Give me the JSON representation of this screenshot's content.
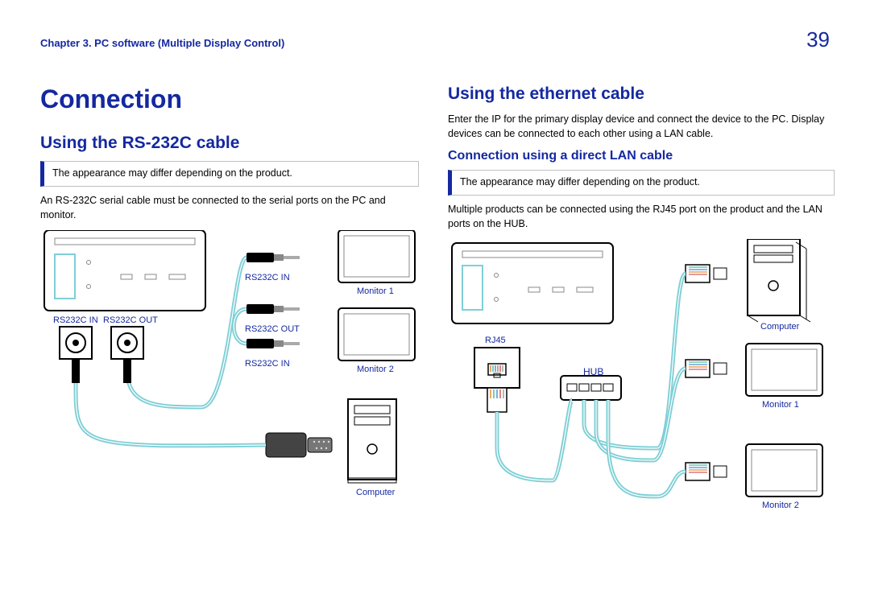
{
  "header": {
    "chapter": "Chapter 3. PC software (Multiple Display Control)",
    "page": "39"
  },
  "left": {
    "title": "Connection",
    "section": "Using the RS-232C cable",
    "note": "The appearance may differ depending on the product.",
    "body": "An RS-232C serial cable must be connected to the serial ports on the PC and monitor.",
    "labels": {
      "rs232c_in_left": "RS232C IN",
      "rs232c_out_left": "RS232C OUT",
      "rs232c_in_top": "RS232C IN",
      "rs232c_out_mid": "RS232C OUT",
      "rs232c_in_bot": "RS232C IN",
      "monitor1": "Monitor 1",
      "monitor2": "Monitor 2",
      "computer": "Computer"
    }
  },
  "right": {
    "section": "Using the ethernet cable",
    "body1": "Enter the IP for the primary display device and connect the device to the PC. Display devices can be connected to each other using a LAN cable.",
    "subsection": "Connection using a direct LAN cable",
    "note": "The appearance may differ depending on the product.",
    "body2": "Multiple products can be connected using the RJ45 port on the product and the LAN ports on the HUB.",
    "labels": {
      "rj45": "RJ45",
      "hub": "HUB",
      "computer": "Computer",
      "monitor1": "Monitor 1",
      "monitor2": "Monitor 2"
    }
  }
}
